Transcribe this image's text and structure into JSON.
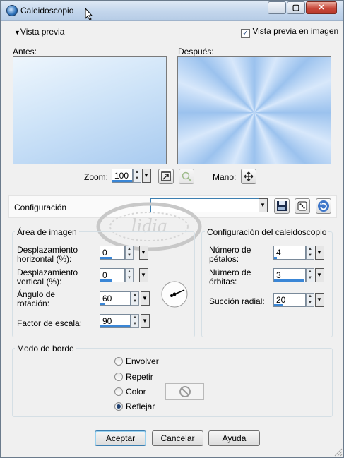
{
  "window": {
    "title": "Caleidoscopio",
    "controls": {
      "minimize": "—",
      "maximize": "▢",
      "close": "✕"
    }
  },
  "preview": {
    "toggle_label": "Vista previa",
    "image_preview_checkbox": {
      "label": "Vista previa en imagen",
      "checked": true
    },
    "before_label": "Antes:",
    "after_label": "Después:",
    "zoom_label": "Zoom:",
    "zoom_value": "100",
    "hand_label": "Mano:"
  },
  "config": {
    "label": "Configuración",
    "value": ""
  },
  "image_area": {
    "title": "Área de imagen",
    "fields": [
      {
        "label": "Desplazamiento horizontal (%):",
        "value": "0",
        "fill_fraction": 0.5
      },
      {
        "label": "Desplazamiento vertical (%):",
        "value": "0",
        "fill_fraction": 0.5
      },
      {
        "label": "Ángulo de rotación:",
        "value": "60",
        "fill_fraction": 0.17
      },
      {
        "label": "Factor de escala:",
        "value": "90",
        "fill_fraction": 1.0
      }
    ]
  },
  "kaleido": {
    "title": "Configuración del caleidoscopio",
    "fields": [
      {
        "label": "Número de pétalos:",
        "value": "4",
        "fill_fraction": 0.1
      },
      {
        "label": "Número de órbitas:",
        "value": "3",
        "fill_fraction": 0.95
      },
      {
        "label": "Succión radial:",
        "value": "20",
        "fill_fraction": 0.3
      }
    ]
  },
  "border_mode": {
    "title": "Modo de borde",
    "options": [
      {
        "label": "Envolver",
        "selected": false
      },
      {
        "label": "Repetir",
        "selected": false
      },
      {
        "label": "Color",
        "selected": false
      },
      {
        "label": "Reflejar",
        "selected": true
      }
    ]
  },
  "buttons": {
    "ok": "Aceptar",
    "cancel": "Cancelar",
    "help": "Ayuda"
  },
  "watermark": "lidia",
  "colors": {
    "accent": "#3a86d6",
    "title_bar": "#c3d6ec",
    "close": "#c8483a"
  }
}
